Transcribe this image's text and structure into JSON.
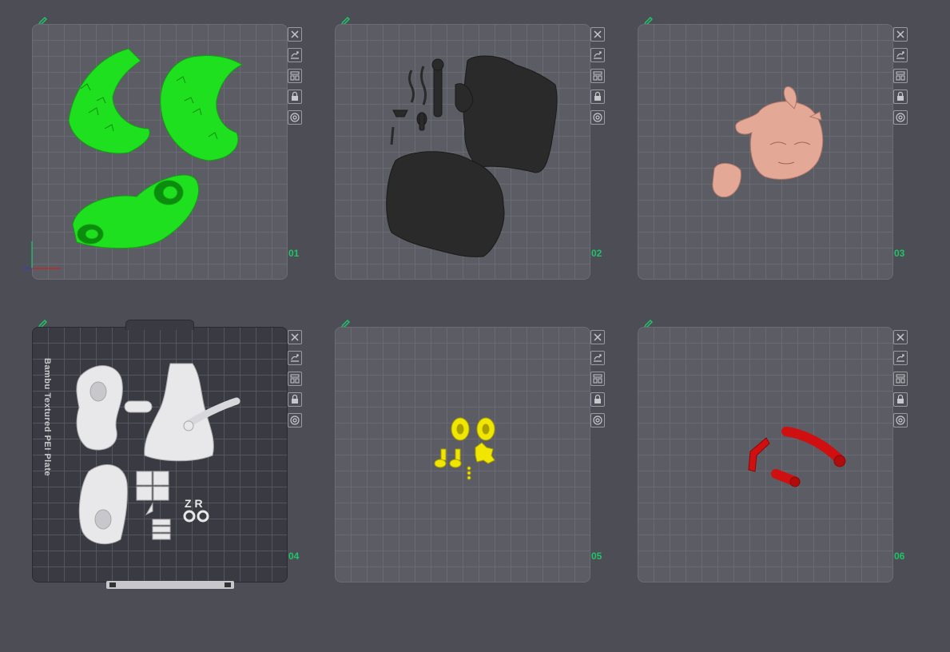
{
  "plates": [
    {
      "number": "01",
      "color": "#1fe01f"
    },
    {
      "number": "02",
      "color": "#2a2a2a"
    },
    {
      "number": "03",
      "color": "#e4a896"
    },
    {
      "number": "04",
      "color": "#e8e8ea",
      "bed_label": "Bambu Textured PEI Plate"
    },
    {
      "number": "05",
      "color": "#f0e600"
    },
    {
      "number": "06",
      "color": "#d01010"
    }
  ],
  "toolbar_icons": [
    "close-icon",
    "auto-orient-icon",
    "arrange-icon",
    "lock-icon",
    "settings-icon"
  ],
  "accent": "#1fc46a"
}
